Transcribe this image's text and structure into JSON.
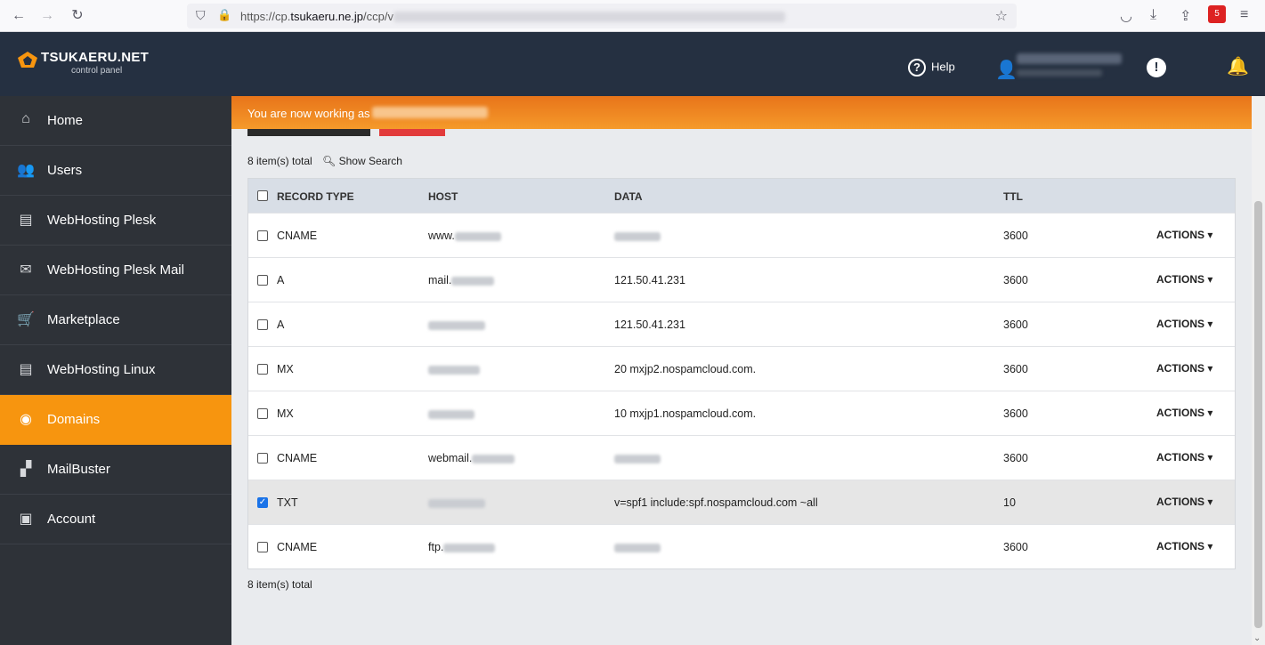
{
  "browser": {
    "url_host": "https://cp.",
    "url_domain": "tsukaeru.ne.jp",
    "url_path": "/ccp/v",
    "ext_badge": "5",
    "icons": [
      "back-icon",
      "forward-icon",
      "reload-icon",
      "shield-icon",
      "lock-icon",
      "star-icon",
      "pocket-icon",
      "download-icon",
      "share-icon",
      "menu-icon"
    ]
  },
  "header": {
    "logo_name": "TSUKAERU.NET",
    "logo_sub": "control panel",
    "help_label": "Help",
    "colors": {
      "header_bg": "#253041",
      "accent": "#f7950f"
    }
  },
  "sidebar": {
    "items": [
      {
        "label": "Home",
        "icon": "home-icon",
        "glyph": "⌂"
      },
      {
        "label": "Users",
        "icon": "users-icon",
        "glyph": "👥"
      },
      {
        "label": "WebHosting Plesk",
        "icon": "hosting-icon",
        "glyph": "▤"
      },
      {
        "label": "WebHosting Plesk Mail",
        "icon": "mail-icon",
        "glyph": "✉"
      },
      {
        "label": "Marketplace",
        "icon": "cart-icon",
        "glyph": "🛒"
      },
      {
        "label": "WebHosting Linux",
        "icon": "hosting-linux-icon",
        "glyph": "▤"
      },
      {
        "label": "Domains",
        "icon": "globe-icon",
        "glyph": "◉",
        "active": true
      },
      {
        "label": "MailBuster",
        "icon": "mailbuster-icon",
        "glyph": "▞"
      },
      {
        "label": "Account",
        "icon": "briefcase-icon",
        "glyph": "▣"
      }
    ]
  },
  "main": {
    "banner_text": "You are now working as",
    "count_text": "8 item(s) total",
    "show_search": "Show Search",
    "table": {
      "headers": {
        "type": "RECORD TYPE",
        "host": "HOST",
        "data": "DATA",
        "ttl": "TTL"
      },
      "actions_label": "ACTIONS",
      "rows": [
        {
          "type": "CNAME",
          "host": "www.",
          "data": "",
          "ttl": "3600",
          "checked": false
        },
        {
          "type": "A",
          "host": "mail.",
          "data": "121.50.41.231",
          "ttl": "3600",
          "checked": false
        },
        {
          "type": "A",
          "host": "",
          "data": "121.50.41.231",
          "ttl": "3600",
          "checked": false
        },
        {
          "type": "MX",
          "host": "",
          "data": "20 mxjp2.nospamcloud.com.",
          "ttl": "3600",
          "checked": false
        },
        {
          "type": "MX",
          "host": "",
          "data": "10 mxjp1.nospamcloud.com.",
          "ttl": "3600",
          "checked": false
        },
        {
          "type": "CNAME",
          "host": "webmail.",
          "data": "",
          "ttl": "3600",
          "checked": false
        },
        {
          "type": "TXT",
          "host": "",
          "data": "v=spf1 include:spf.nospamcloud.com ~all",
          "ttl": "10",
          "checked": true
        },
        {
          "type": "CNAME",
          "host": "ftp.",
          "data": "",
          "ttl": "3600",
          "checked": false
        }
      ]
    },
    "count_bottom": "8 item(s) total"
  }
}
